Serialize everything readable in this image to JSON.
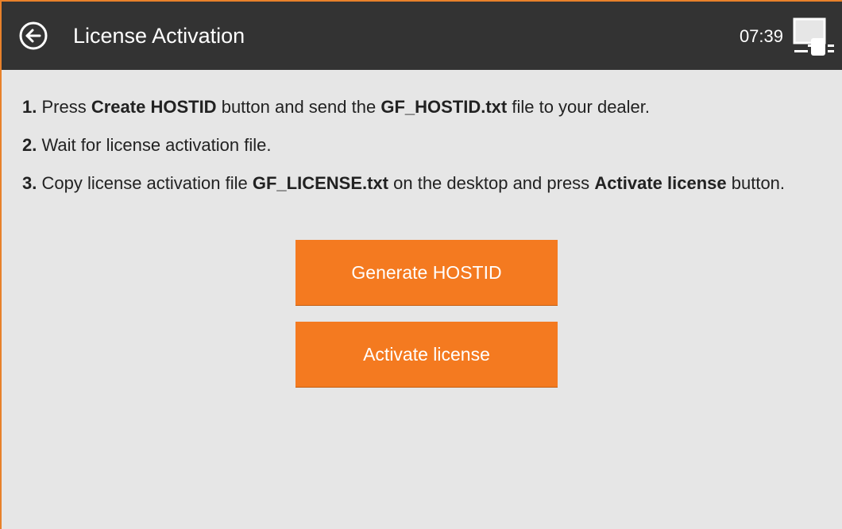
{
  "header": {
    "title": "License Activation",
    "clock": "07:39",
    "back_icon": "back-arrow-circle-icon",
    "display_icon": "display-settings-icon"
  },
  "steps": [
    {
      "num": "1.",
      "t1": "Press",
      "b1": "Create HOSTID",
      "t2": "button and send the",
      "b2": "GF_HOSTID.txt",
      "t3": "file to your dealer."
    },
    {
      "num": "2.",
      "t1": "Wait for license activation file."
    },
    {
      "num": "3.",
      "t1": "Copy license activation file",
      "b1": "GF_LICENSE.txt",
      "t2": "on the desktop and press",
      "b2": "Activate license",
      "t3": "button."
    }
  ],
  "buttons": {
    "generate": "Generate HOSTID",
    "activate": "Activate license"
  },
  "colors": {
    "header_bg": "#333333",
    "accent": "#f47a20",
    "page_bg": "#e6e6e6"
  }
}
